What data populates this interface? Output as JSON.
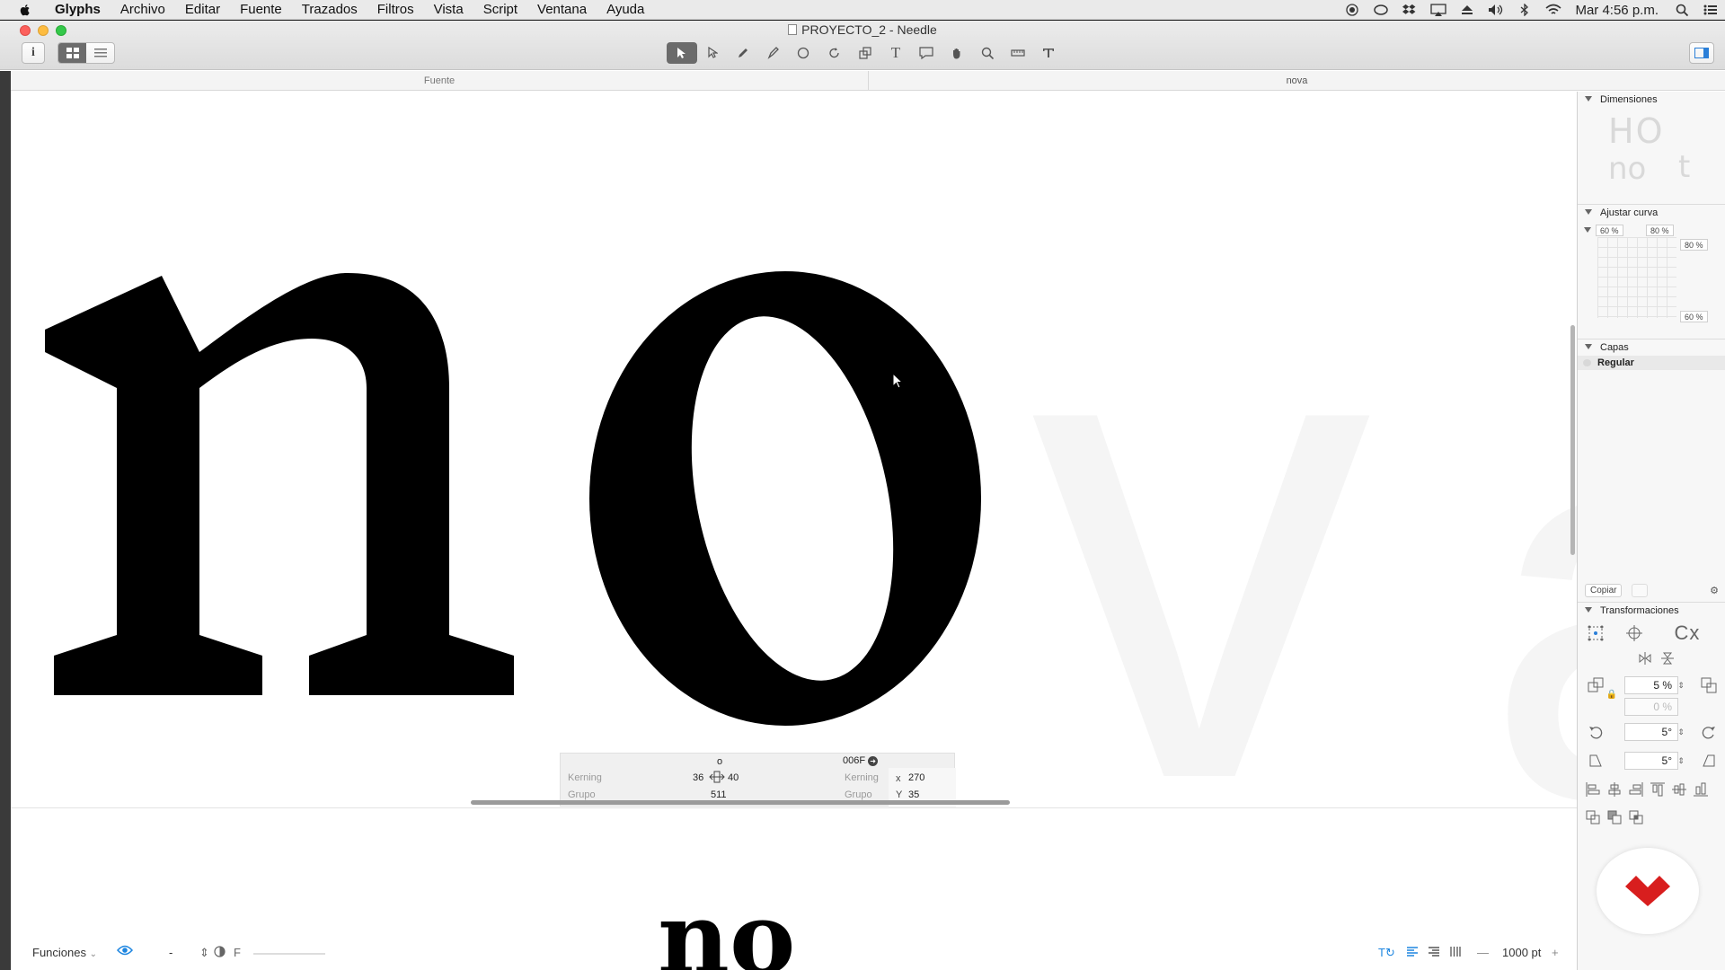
{
  "menubar": {
    "app_name": "Glyphs",
    "items": [
      "Archivo",
      "Editar",
      "Fuente",
      "Trazados",
      "Filtros",
      "Vista",
      "Script",
      "Ventana",
      "Ayuda"
    ],
    "clock": "Mar 4:56 p.m."
  },
  "window": {
    "title": "PROYECTO_2 - Needle",
    "info_label": "i"
  },
  "tabs": {
    "left": "Fuente",
    "right": "nova"
  },
  "canvas": {
    "ghost_v": "v",
    "ghost_a": "a"
  },
  "glyph_info": {
    "glyph_name": "o",
    "unicode": "006F",
    "kerning_label": "Kerning",
    "kerning_left": "36",
    "kerning_right": "40",
    "group_label": "Grupo",
    "group_value": "511",
    "kerning_label_right": "Kerning",
    "group_label_right": "Grupo",
    "x_label": "x",
    "x_value": "270",
    "y_label": "Y",
    "y_value": "35"
  },
  "preview": {
    "text": "no"
  },
  "bottombar": {
    "funciones": "Funciones",
    "minus": "-",
    "f_label": "F",
    "zoom": "1000 pt",
    "zoom_minus": "—",
    "zoom_plus": "+"
  },
  "sidebar": {
    "dimensions_title": "Dimensiones",
    "dim_big": "HO",
    "dim_small_1": "no",
    "dim_small_2": "t",
    "curve_title": "Ajustar curva",
    "curve_pct_1": "60 %",
    "curve_pct_2": "80 %",
    "curve_pct_3": "80 %",
    "curve_pct_4": "60 %",
    "layers_title": "Capas",
    "layer_regular": "Regular",
    "copy_label": "Copiar",
    "transform_title": "Transformaciones",
    "scale_value": "5 %",
    "scale_value_2": "0 %",
    "rotate_value": "5°",
    "slant_value": "5°",
    "transform_cx": "Cx"
  },
  "colors": {
    "accent_blue": "#1e86e0",
    "brand_red": "#d81e1e",
    "glyph_black": "#000000"
  }
}
